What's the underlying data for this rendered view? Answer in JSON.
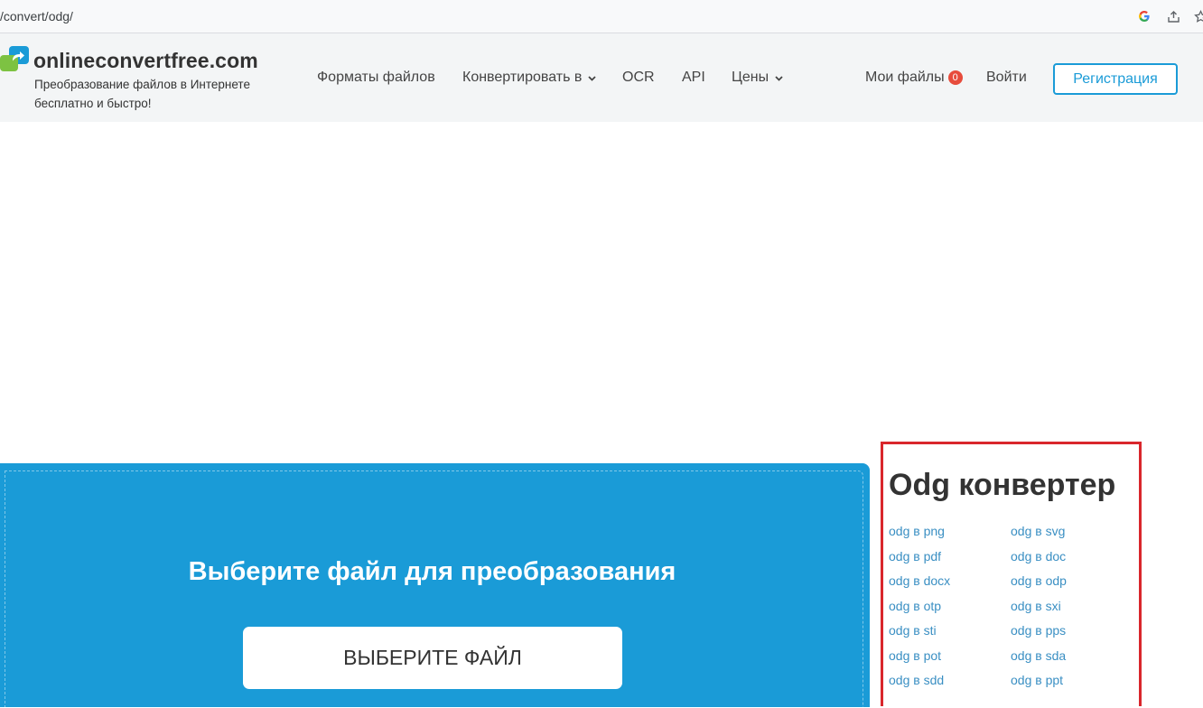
{
  "browser": {
    "url": "/convert/odg/",
    "icons": [
      "google-icon",
      "share-icon",
      "star-icon"
    ]
  },
  "header": {
    "brand": "onlineconvertfree.com",
    "tagline": "Преобразование файлов в Интернете бесплатно и быстро!",
    "nav": {
      "formats": "Форматы файлов",
      "convert": "Конвертировать в",
      "ocr": "OCR",
      "api": "API",
      "prices": "Цены"
    },
    "my_files": "Мои файлы",
    "my_files_count": "0",
    "login": "Войти",
    "register": "Регистрация"
  },
  "upload": {
    "title": "Выберите файл для преобразования",
    "button": "ВЫБЕРИТЕ ФАЙЛ"
  },
  "converter": {
    "title": "Odg конвертер",
    "links": [
      [
        "odg в png",
        "odg в svg"
      ],
      [
        "odg в pdf",
        "odg в doc"
      ],
      [
        "odg в docx",
        "odg в odp"
      ],
      [
        "odg в otp",
        "odg в sxi"
      ],
      [
        "odg в sti",
        "odg в pps"
      ],
      [
        "odg в pot",
        "odg в sda"
      ],
      [
        "odg в sdd",
        "odg в ppt"
      ]
    ]
  },
  "colors": {
    "accent": "#1a9bd7",
    "badge": "#e74c3c",
    "highlight_border": "#d9262c",
    "link": "#3a8fc3"
  }
}
